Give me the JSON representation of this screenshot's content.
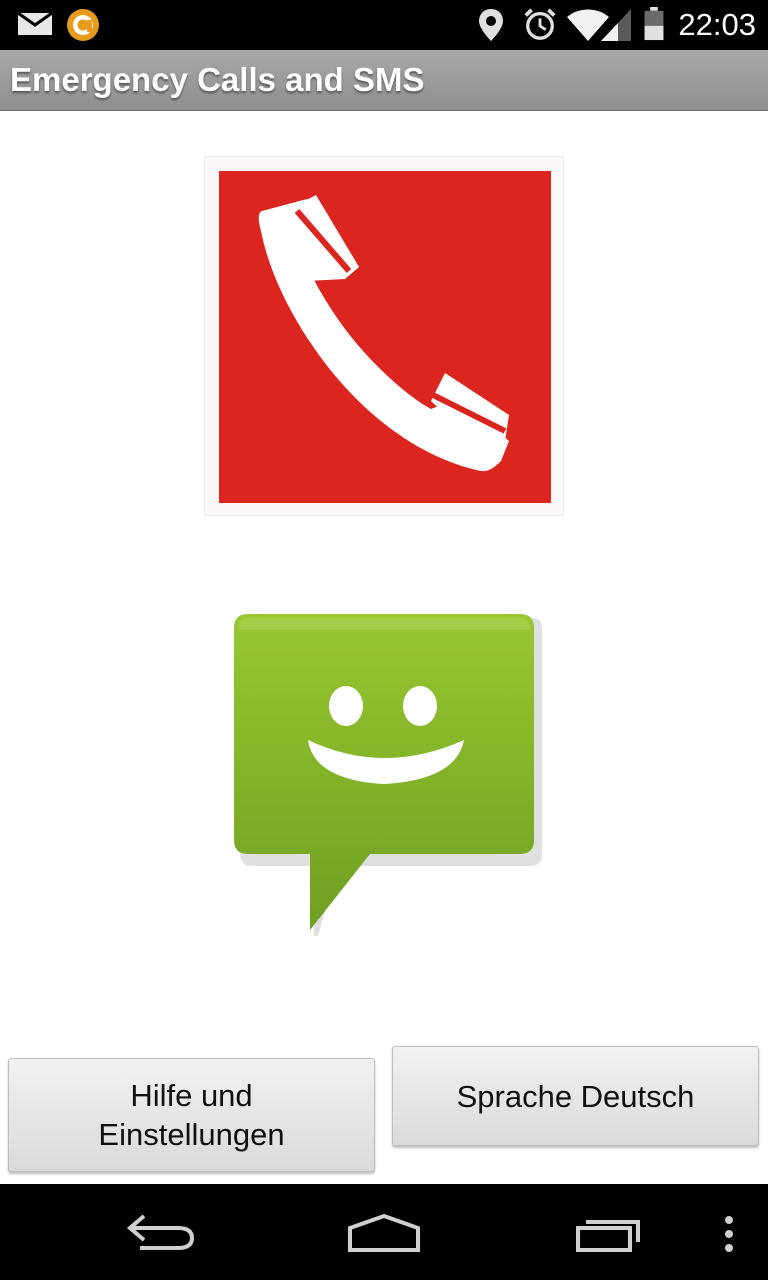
{
  "status_bar": {
    "time": "22:03",
    "icons": [
      "mail-icon",
      "app-notification-icon",
      "location-icon",
      "alarm-icon",
      "wifi-icon",
      "signal-icon",
      "battery-icon"
    ]
  },
  "app": {
    "title": "Emergency Calls and SMS"
  },
  "tiles": {
    "call_icon": "phone-handset-icon",
    "call_color": "#db251e",
    "sms_icon": "sms-smiley-bubble-icon",
    "sms_color": "#8bbb2a"
  },
  "buttons": {
    "help_label": "Hilfe und\nEinstellungen",
    "language_label": "Sprache Deutsch"
  },
  "nav_bar": {
    "icons": [
      "back-icon",
      "home-icon",
      "recent-apps-icon",
      "overflow-menu-icon"
    ]
  }
}
